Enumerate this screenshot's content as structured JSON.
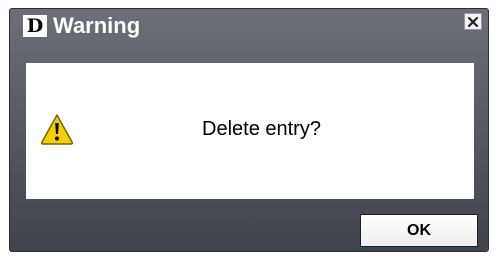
{
  "window": {
    "title": "Warning",
    "logo_letter": "D",
    "close_icon": "close-icon"
  },
  "message": {
    "icon": "warning-icon",
    "text": "Delete entry?"
  },
  "buttons": {
    "ok_label": "OK"
  },
  "colors": {
    "dialog_frame_top": "#6b6f78",
    "dialog_frame_bottom": "#3f434b",
    "message_background": "#ffffff",
    "warning_yellow": "#f5d000"
  }
}
